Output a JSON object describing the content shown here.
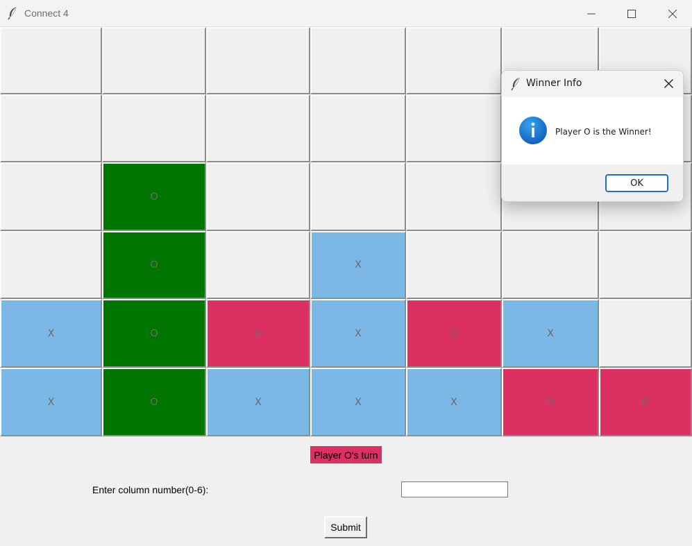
{
  "window": {
    "title": "Connect 4",
    "icon": "feather-icon",
    "controls": [
      "minimize-icon",
      "maximize-icon",
      "close-icon"
    ]
  },
  "colors": {
    "empty": "#f0f0f0",
    "player_x": "#7cb8e6",
    "player_o": "#dd3062",
    "winning_o": "#007600",
    "turn_label_bg": "#dd3062"
  },
  "board": {
    "rows": 6,
    "cols": 7,
    "cells": [
      [
        "",
        "",
        "",
        "",
        "",
        "",
        ""
      ],
      [
        "",
        "",
        "",
        "",
        "",
        "",
        ""
      ],
      [
        "",
        "O",
        "",
        "",
        "",
        "",
        ""
      ],
      [
        "",
        "O",
        "",
        "X",
        "",
        "",
        ""
      ],
      [
        "X",
        "O",
        "O",
        "X",
        "O",
        "X",
        ""
      ],
      [
        "X",
        "O",
        "X",
        "X",
        "X",
        "O",
        "O"
      ]
    ],
    "winning_cells": [
      [
        2,
        1
      ],
      [
        3,
        1
      ],
      [
        4,
        1
      ],
      [
        5,
        1
      ]
    ]
  },
  "status": {
    "turn_label": "Player O's turn"
  },
  "input": {
    "label": "Enter column number(0-6):",
    "value": ""
  },
  "submit_label": "Submit",
  "dialog": {
    "title": "Winner Info",
    "message": "Player O is the Winner!",
    "ok_label": "OK",
    "icon": "info-icon"
  }
}
